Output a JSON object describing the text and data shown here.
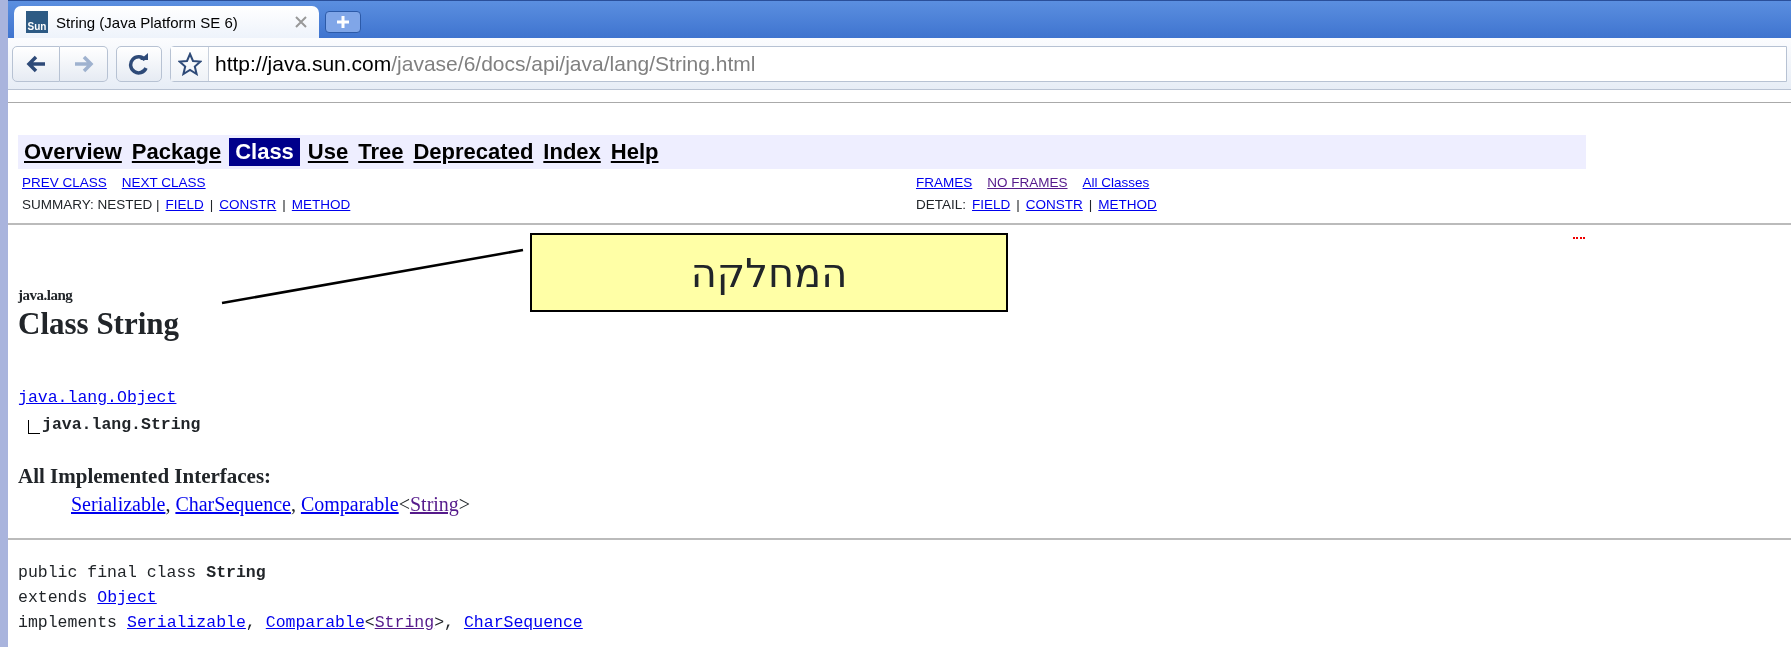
{
  "browser": {
    "tabs": [
      {
        "favicon_text": "Sun",
        "title": "String (Java Platform SE 6)",
        "selected": true
      }
    ],
    "forward_disabled": true,
    "url_host": "http://java.sun.com",
    "url_path": "/javase/6/docs/api/java/lang/String.html"
  },
  "nav": [
    {
      "label": "Overview",
      "selected": false
    },
    {
      "label": "Package",
      "selected": false
    },
    {
      "label": "Class",
      "selected": true
    },
    {
      "label": "Use",
      "selected": false
    },
    {
      "label": "Tree",
      "selected": false
    },
    {
      "label": "Deprecated",
      "selected": false
    },
    {
      "label": "Index",
      "selected": false
    },
    {
      "label": "Help",
      "selected": false
    }
  ],
  "subnav_left": [
    [
      {
        "kind": "link",
        "text": "PREV CLASS",
        "visited": false
      },
      {
        "kind": "link",
        "text": "NEXT CLASS",
        "visited": false
      }
    ],
    [
      {
        "kind": "text",
        "text": "SUMMARY: NESTED |"
      },
      {
        "kind": "link",
        "text": "FIELD",
        "visited": false
      },
      {
        "kind": "text",
        "text": "|"
      },
      {
        "kind": "link",
        "text": "CONSTR",
        "visited": false
      },
      {
        "kind": "text",
        "text": "|"
      },
      {
        "kind": "link",
        "text": "METHOD",
        "visited": false
      }
    ]
  ],
  "subnav_right": [
    [
      {
        "kind": "link",
        "text": "FRAMES",
        "visited": false
      },
      {
        "kind": "link",
        "text": "NO FRAMES",
        "visited": true
      },
      {
        "kind": "link",
        "text": "All Classes",
        "visited": false
      }
    ],
    [
      {
        "kind": "text",
        "text": "DETAIL:"
      },
      {
        "kind": "link",
        "text": "FIELD",
        "visited": false
      },
      {
        "kind": "text",
        "text": "|"
      },
      {
        "kind": "link",
        "text": "CONSTR",
        "visited": false
      },
      {
        "kind": "text",
        "text": "|"
      },
      {
        "kind": "link",
        "text": "METHOD",
        "visited": false
      }
    ]
  ],
  "package": "java.lang",
  "class_title": "Class String",
  "callout": "המחלקה",
  "hierarchy": {
    "parent": "java.lang.Object",
    "child": "java.lang.String"
  },
  "interfaces_heading": "All Implemented Interfaces:",
  "interfaces": [
    {
      "kind": "link",
      "text": "Serializable",
      "visited": false
    },
    {
      "kind": "text",
      "text": ","
    },
    {
      "kind": "link",
      "text": "CharSequence",
      "visited": false
    },
    {
      "kind": "text",
      "text": ","
    },
    {
      "kind": "link",
      "text": "Comparable",
      "visited": false
    },
    {
      "kind": "text",
      "text": "<"
    },
    {
      "kind": "link",
      "text": "String",
      "visited": true
    },
    {
      "kind": "text",
      "text": ">"
    }
  ],
  "declaration": [
    [
      {
        "kind": "text",
        "text": "public final class"
      },
      {
        "kind": "bold",
        "text": "String"
      }
    ],
    [
      {
        "kind": "text",
        "text": "extends"
      },
      {
        "kind": "link",
        "text": "Object",
        "visited": false
      }
    ],
    [
      {
        "kind": "text",
        "text": "implements"
      },
      {
        "kind": "link",
        "text": "Serializable",
        "visited": false
      },
      {
        "kind": "text",
        "text": ","
      },
      {
        "kind": "link",
        "text": "Comparable",
        "visited": false
      },
      {
        "kind": "text",
        "text": "<"
      },
      {
        "kind": "link",
        "text": "String",
        "visited": true
      },
      {
        "kind": "text",
        "text": ">,"
      },
      {
        "kind": "link",
        "text": "CharSequence",
        "visited": false
      }
    ]
  ]
}
